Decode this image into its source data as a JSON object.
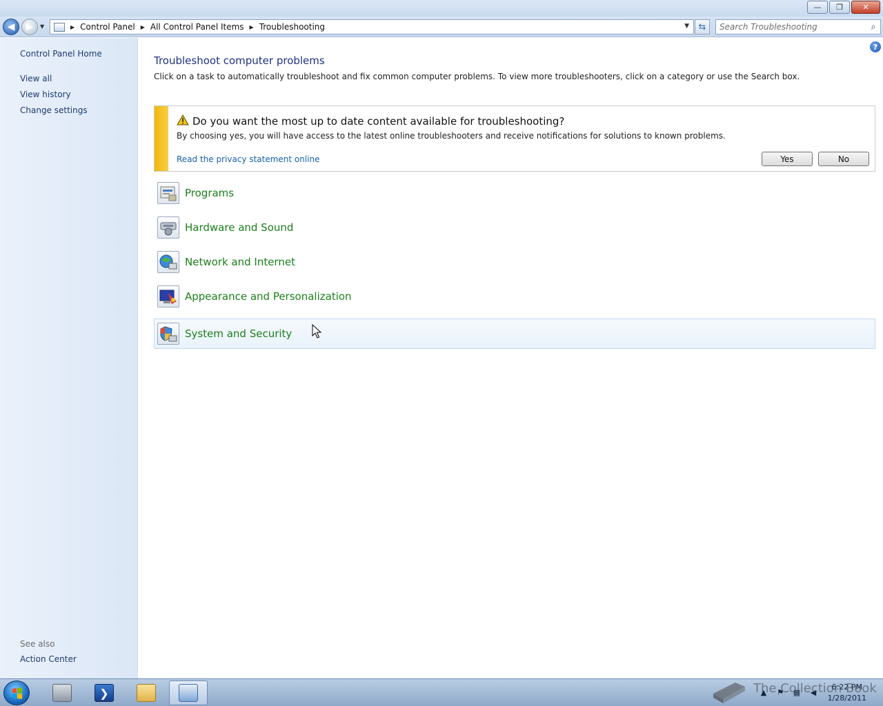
{
  "window": {
    "caption_minimize": "—",
    "caption_restore": "❐",
    "caption_close": "✕"
  },
  "address": {
    "breadcrumbs": [
      "Control Panel",
      "All Control Panel Items",
      "Troubleshooting"
    ],
    "search_placeholder": "Search Troubleshooting"
  },
  "sidebar": {
    "home": "Control Panel Home",
    "links": [
      "View all",
      "View history",
      "Change settings"
    ],
    "see_also_label": "See also",
    "see_also_links": [
      "Action Center"
    ]
  },
  "main": {
    "title": "Troubleshoot computer problems",
    "description": "Click on a task to automatically troubleshoot and fix common computer problems. To view more troubleshooters, click on a category or use the Search box.",
    "infobar": {
      "title": "Do you want the most up to date content available for troubleshooting?",
      "text": "By choosing yes, you will have access to the latest online troubleshooters and receive notifications for solutions to known problems.",
      "link": "Read the privacy statement online",
      "yes_label": "Yes",
      "no_label": "No",
      "stripe_color": "#f3b70d"
    },
    "categories": [
      {
        "label": "Programs",
        "icon": "programs-icon"
      },
      {
        "label": "Hardware and Sound",
        "icon": "hardware-sound-icon"
      },
      {
        "label": "Network and Internet",
        "icon": "network-internet-icon"
      },
      {
        "label": "Appearance and Personalization",
        "icon": "appearance-personalization-icon"
      },
      {
        "label": "System and Security",
        "icon": "system-security-icon",
        "hovered": true
      }
    ],
    "category_color": "#1b7f1b"
  },
  "taskbar": {
    "clock_time": "6:22 PM",
    "clock_date": "1/28/2011",
    "watermark": "The Collection Book"
  }
}
